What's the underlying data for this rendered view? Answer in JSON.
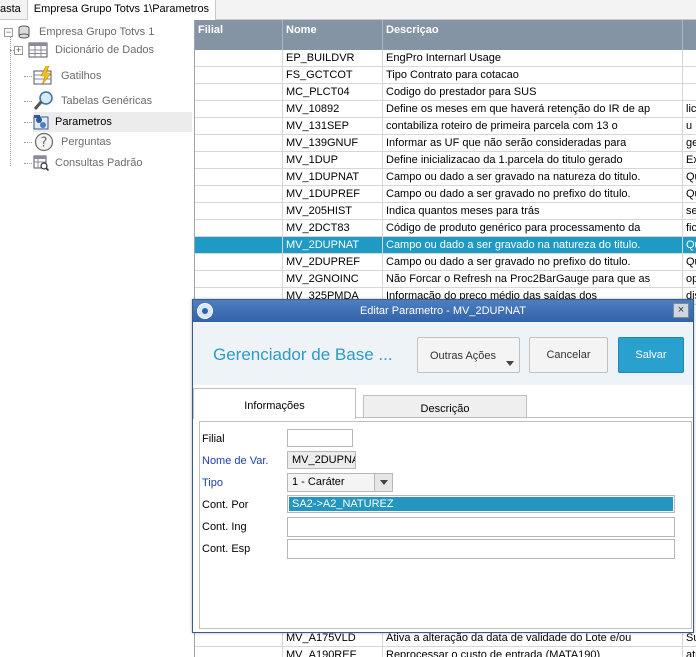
{
  "top_tabs": [
    "asta",
    "Empresa Grupo Totvs 1\\Parametros"
  ],
  "tree": {
    "root": "Empresa Grupo Totvs 1",
    "items": [
      {
        "label": "Dicionário de Dados",
        "icon": "table-icon"
      },
      {
        "label": "Gatilhos",
        "icon": "trigger-icon"
      },
      {
        "label": "Tabelas Genéricas",
        "icon": "magnifier-icon"
      },
      {
        "label": "Parametros",
        "icon": "parameters-icon"
      },
      {
        "label": "Perguntas",
        "icon": "question-icon"
      },
      {
        "label": "Consultas Padrão",
        "icon": "query-icon"
      }
    ],
    "selected_index": 3
  },
  "grid": {
    "columns": [
      "Filial",
      "Nome",
      "Descriçao",
      ""
    ],
    "rows": [
      {
        "filial": "",
        "nome": "EP_BUILDVR",
        "desc": "EngPro Internarl Usage",
        "extra": ""
      },
      {
        "filial": "",
        "nome": "FS_GCTCOT",
        "desc": "Tipo Contrato para cotacao",
        "extra": ""
      },
      {
        "filial": "",
        "nome": "MC_PLCT04",
        "desc": "Codigo do prestador para SUS",
        "extra": ""
      },
      {
        "filial": "",
        "nome": "MV_10892",
        "desc": "Define os meses em que haverá retenção do IR de ap",
        "extra": "lica"
      },
      {
        "filial": "",
        "nome": "MV_131SEP",
        "desc": "contabiliza roteiro de primeira parcela com 13 o",
        "extra": "u F"
      },
      {
        "filial": "",
        "nome": "MV_139GNUF",
        "desc": "Informar as UF que não serão consideradas para",
        "extra": "ger"
      },
      {
        "filial": "",
        "nome": "MV_1DUP",
        "desc": "Define inicializacao da 1.parcela do titulo gerado",
        "extra": "Ex"
      },
      {
        "filial": "",
        "nome": "MV_1DUPNAT",
        "desc": "Campo ou dado a ser gravado na natureza do titulo.",
        "extra": "Qu"
      },
      {
        "filial": "",
        "nome": "MV_1DUPREF",
        "desc": "Campo ou dado a ser gravado no prefixo do titulo.",
        "extra": "Qu"
      },
      {
        "filial": "",
        "nome": "MV_205HIST",
        "desc": "Indica quantos meses para trás",
        "extra": "ser"
      },
      {
        "filial": "",
        "nome": "MV_2DCT83",
        "desc": "Código de produto genérico para processamento da",
        "extra": "fic"
      },
      {
        "filial": "",
        "nome": "MV_2DUPNAT",
        "desc": "Campo ou dado a ser gravado na natureza do titulo.",
        "extra": "Qu"
      },
      {
        "filial": "",
        "nome": "MV_2DUPREF",
        "desc": "Campo ou dado a ser gravado no prefixo do titulo.",
        "extra": "Qu"
      },
      {
        "filial": "",
        "nome": "MV_2GNOINC",
        "desc": "Não Forcar o Refresh na Proc2BarGauge para que as",
        "extra": "ope"
      },
      {
        "filial": "",
        "nome": "MV_325PMDA",
        "desc": "Informação do preço médio das saídas dos",
        "extra": "dis"
      }
    ],
    "selected_index": 11,
    "bottom_rows": [
      {
        "filial": "",
        "nome": "MV_A175VLD",
        "desc": "Ativa a alteração da data de validade do Lote e/ou",
        "extra": "Su"
      },
      {
        "filial": "",
        "nome": "MV_A190REF",
        "desc": "Reprocessar o custo de entrada (MATA190)",
        "extra": "atr"
      }
    ]
  },
  "dialog": {
    "title": "Editar Parametro - MV_2DUPNAT",
    "heading": "Gerenciador de Base ...",
    "buttons": {
      "outras": "Outras Ações",
      "cancel": "Cancelar",
      "save": "Salvar"
    },
    "tabs": {
      "info": "Informações",
      "desc": "Descrição"
    },
    "fields": {
      "filial": {
        "label": "Filial",
        "value": ""
      },
      "nome": {
        "label": "Nome de Var.",
        "value": "MV_2DUPNA"
      },
      "tipo": {
        "label": "Tipo",
        "value": "1 - Caráter"
      },
      "cont_por": {
        "label": "Cont. Por",
        "value": "SA2->A2_NATUREZ"
      },
      "cont_ing": {
        "label": "Cont. Ing",
        "value": ""
      },
      "cont_esp": {
        "label": "Cont. Esp",
        "value": ""
      }
    }
  },
  "colors": {
    "accent": "#2aa0cf",
    "grid_header": "#8594a4",
    "selection": "#1e9ac4",
    "title_bar": "#3a6bb0"
  }
}
